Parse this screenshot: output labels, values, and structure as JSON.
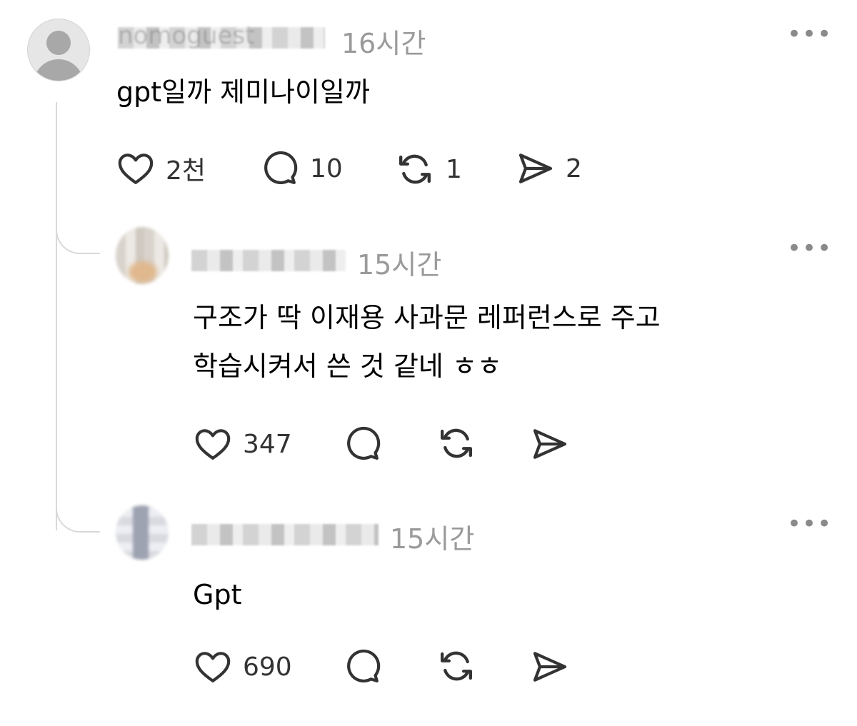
{
  "post": {
    "username": "nomoguest",
    "time": "16시간",
    "text": "gpt일까 제미나이일까",
    "likes": "2천",
    "replies": "10",
    "reposts": "1",
    "shares": "2"
  },
  "reply1": {
    "time": "15시간",
    "text_line1": "구조가 딱 이재용 사과문 레퍼런스로 주고",
    "text_line2": "학습시켜서 쓴 것 같네 ㅎㅎ",
    "likes": "347"
  },
  "reply2": {
    "time": "15시간",
    "text": "Gpt",
    "likes": "690"
  },
  "icons": {
    "like": "heart-icon",
    "reply": "comment-bubble-icon",
    "repost": "repost-icon",
    "share": "send-icon",
    "more": "more-dots-icon"
  },
  "colors": {
    "text": "#000000",
    "muted": "#9a9a9a",
    "icon": "#333333",
    "thread_line": "#d9d9d9"
  }
}
